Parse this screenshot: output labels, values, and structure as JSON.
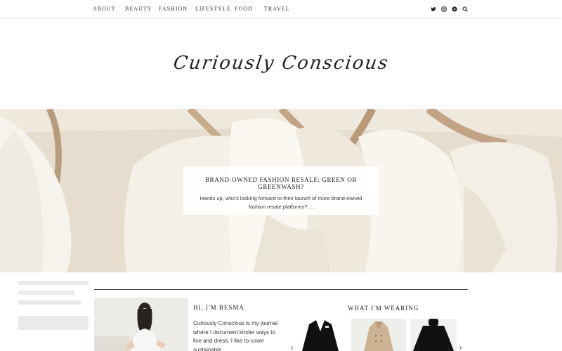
{
  "nav": {
    "items": [
      "ABOUT",
      "BEAUTY",
      "FASHION",
      "LIFESTYLE",
      "FOOD",
      "TRAVEL"
    ],
    "social_icons": [
      "twitter-icon",
      "instagram-icon",
      "pinterest-icon",
      "search-icon"
    ]
  },
  "site": {
    "logo_text": "Curiously Conscious"
  },
  "hero": {
    "title": "BRAND-OWNED FASHION RESALE: GREEN OR GREENWASH?",
    "excerpt": "Hands up, who's looking forward to their launch of more brand-owned fashion resale platforms? ..."
  },
  "about": {
    "title": "HI, I'M BESMA",
    "text": "Curiously Conscious is my journal where I document kinder ways to live and dress. I like to cover sustainable"
  },
  "wearing": {
    "title": "WHAT I'M WEARING",
    "items": [
      "black-blazer",
      "beige-trench-coat",
      "black-turtleneck"
    ]
  },
  "colors": {
    "text": "#222222",
    "hero_bg": "#e8e0d3",
    "overlay": "#ffffff"
  }
}
